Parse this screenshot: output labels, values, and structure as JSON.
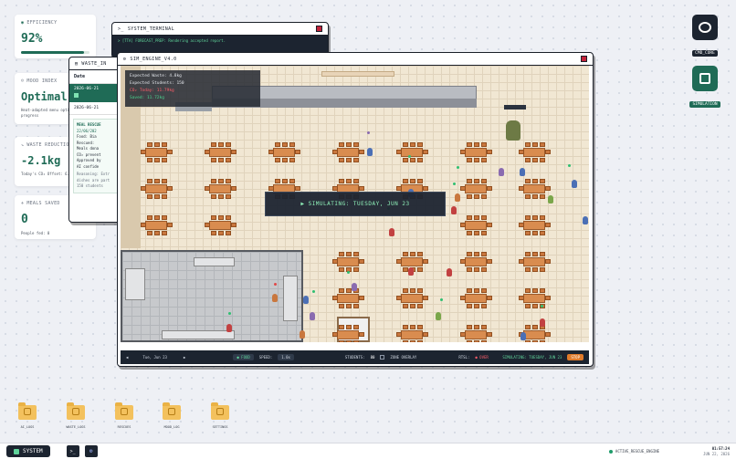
{
  "stats": {
    "efficiency": {
      "label": "EFFICIENCY",
      "value": "92%",
      "progress": 0.92
    },
    "mood": {
      "label": "MOOD INDEX",
      "value": "Optimal",
      "sub": "Heat-adapted menu optimal progress"
    },
    "waste": {
      "label": "WASTE REDUCTION",
      "value": "-2.1kg",
      "sub": "Today's CO₂ Offset: 6.3kg"
    },
    "meals": {
      "label": "MEALS SAVED",
      "value": "0",
      "sub": "People fed: 0"
    }
  },
  "terminal": {
    "title": "SYSTEM_TERMINAL",
    "line": "> [TTA] FORECAST_PREP: Rendering accepted report."
  },
  "waste_window": {
    "title": "WASTE_IN",
    "date_header": "Date",
    "dates": [
      "2026-06-21",
      "2026-06-21"
    ],
    "rescue_title": "MEAL RESCUE",
    "rescue_date": "22/06/202",
    "rescue_items": [
      "Food: Bia",
      "Rescued:",
      "Meals dona",
      "CO₂ prevent",
      "Approved by",
      "AI confide"
    ],
    "reasoning": [
      "Reasoning: Extr",
      "dishes are part",
      "150 students"
    ]
  },
  "sim": {
    "title": "SIM_ENGINE_V4.0",
    "overlay": {
      "expected_waste": "Expected Waste: 4.8kg",
      "expected_students": "Expected Students: 150",
      "co2_today": "CO₂ Today: 11.79kg",
      "saved": "Saved: 11.72kg"
    },
    "banner": "▶ SIMULATING: TUESDAY, JUN 23",
    "controls": {
      "prev": "◀",
      "date": "Tue, Jun 23",
      "next": "▶",
      "mode": "● FOOD",
      "speed_label": "SPEED:",
      "speed_value": "1.0x",
      "students_label": "STUDENTS:",
      "students_value": "80",
      "zone_overlay": "ZONE OVERLAY",
      "rtsl_label": "RTSL:",
      "rtsl_value": "● OVER",
      "status": "SIMULATING: TUESDAY, JUN 23",
      "stop": "STOP"
    }
  },
  "desktop_right": {
    "cmd": {
      "label": "CMD_CORE"
    },
    "simulation": {
      "label": "SIMULATION"
    }
  },
  "desktop_icons": [
    {
      "label": "AI_LOGS"
    },
    {
      "label": "WASTE_LOGS"
    },
    {
      "label": "RESCUES"
    },
    {
      "label": "MOOD_LOG"
    },
    {
      "label": "SETTINGS"
    }
  ],
  "taskbar": {
    "system": "SYSTEM",
    "status": "ACTIVE_RESCUE_ENGINE",
    "time": "01:57:24",
    "date": "JUN 22, 2026"
  },
  "colors": {
    "accent": "#1f6b56",
    "alert": "#c3243b",
    "chrome": "#1c2430"
  }
}
